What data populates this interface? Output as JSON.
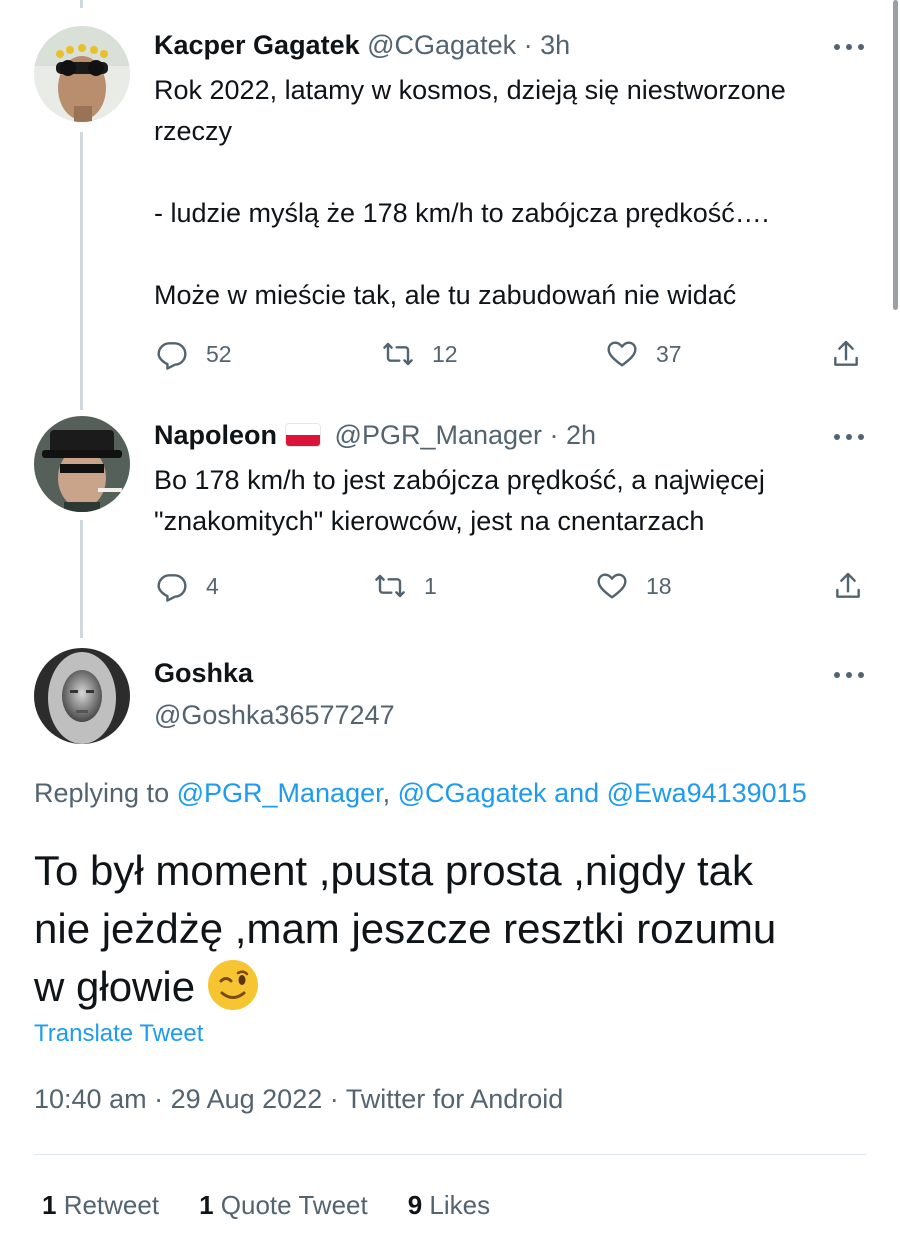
{
  "tweets": [
    {
      "name": "Kacper Gagatek",
      "handle_time": "@CGagatek · 3h",
      "lines": [
        "Rok 2022, latamy w kosmos, dzieją się niestworzone",
        "rzeczy",
        "",
        "- ludzie myślą że 178 km/h to zabójcza prędkość….",
        "",
        "Może w mieście tak, ale tu zabudowań nie widać"
      ],
      "replies": "52",
      "retweets": "12",
      "likes": "37"
    },
    {
      "name": "Napoleon",
      "handle_time": "@PGR_Manager · 2h",
      "lines": [
        "Bo 178 km/h to jest zabójcza prędkość, a najwięcej",
        "\"znakomitych\" kierowców, jest na cnentarzach"
      ],
      "replies": "4",
      "retweets": "1",
      "likes": "18"
    }
  ],
  "main": {
    "name": "Goshka",
    "handle": "@Goshka36577247",
    "replying_prefix": "Replying to ",
    "replying_user1": "@PGR_Manager",
    "replying_sep": ", ",
    "replying_rest": "@CGagatek and @Ewa94139015",
    "text_line1": "To był moment ,pusta prosta ,nigdy tak",
    "text_line2": "nie jeżdżę ,mam jeszcze resztki rozumu",
    "text_line3": "w głowie",
    "emoji": "winking-face",
    "translate": "Translate Tweet",
    "timestamp": "10:40 am · 29 Aug 2022 · Twitter for Android",
    "retweets_count": "1",
    "retweets_label": " Retweet",
    "quotes_count": "1",
    "quotes_label": " Quote Tweet",
    "likes_count": "9",
    "likes_label": " Likes"
  },
  "icons": {
    "reply": "reply-icon",
    "retweet": "retweet-icon",
    "like": "heart-icon",
    "share": "share-icon",
    "more": "more-icon"
  },
  "colors": {
    "text": "#0f1419",
    "secondary": "#536471",
    "link": "#1d9bf0",
    "thread_line": "#cfd9de",
    "flag_red": "#dc143c"
  }
}
